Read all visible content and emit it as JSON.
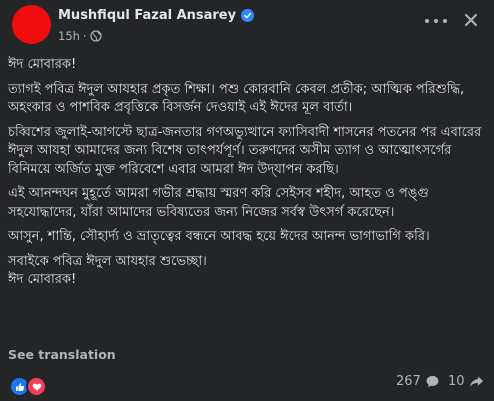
{
  "post": {
    "author": "Mushfiqul Fazal Ansarey",
    "time": "15h",
    "separator": "·",
    "paragraphs": [
      "ঈদ মোবারক!",
      "ত্যাগই পবিত্র ঈদুল আযহার প্রকৃত শিক্ষা। পশু কোরবানি কেবল প্রতীক; আত্মিক পরিশুদ্ধি, অহংকার ও পাশবিক প্রবৃত্তিকে বিসর্জন দেওয়াই এই ঈদের মূল বার্তা।",
      "চব্বিশের জুলাই-আগস্টে ছাত্র-জনতার গণঅভ্যুত্থানে ফ্যাসিবাদী শাসনের পতনের পর এবারের ঈদুল আযহা আমাদের জন্য বিশেষ তাৎপর্যপূর্ণ। তরুণদের অসীম ত্যাগ ও আত্মোৎসর্গের বিনিময়ে অর্জিত মুক্ত পরিবেশে এবার আমরা ঈদ উদ্‌যাপন করছি।",
      "এই আনন্দঘন মুহূর্তে আমরা গভীর শ্রদ্ধায় স্মরণ করি সেইসব শহীদ, আহত ও পঙ্গু সহযোদ্ধাদের, যাঁরা আমাদের ভবিষ্যতের জন্য নিজের সর্বস্ব উৎসর্গ করেছেন।",
      "আসুন, শান্তি, সৌহার্দ্য ও ভ্রাতৃত্বের বন্ধনে আবদ্ধ হয়ে ঈদের আনন্দ ভাগাভাগি করি।",
      "সবাইকে পবিত্র ঈদুল আযহার শুভেচ্ছা।\nঈদ মোবারক!"
    ],
    "see_translation": "See translation",
    "comment_count": "267",
    "share_count": "10"
  },
  "icons": {
    "verified": "verified-badge-icon",
    "privacy": "globe-icon",
    "more": "more-options-icon",
    "close": "close-icon",
    "like": "like-reaction-icon",
    "love": "love-reaction-icon",
    "comment": "comment-icon",
    "share": "share-icon"
  },
  "colors": {
    "background": "#242526",
    "text": "#e4e6eb",
    "secondary_text": "#b0b3b8",
    "avatar": "#ef0d0d",
    "verified": "#2d88ff",
    "like": "#1877f2",
    "love": "#f33e58"
  }
}
